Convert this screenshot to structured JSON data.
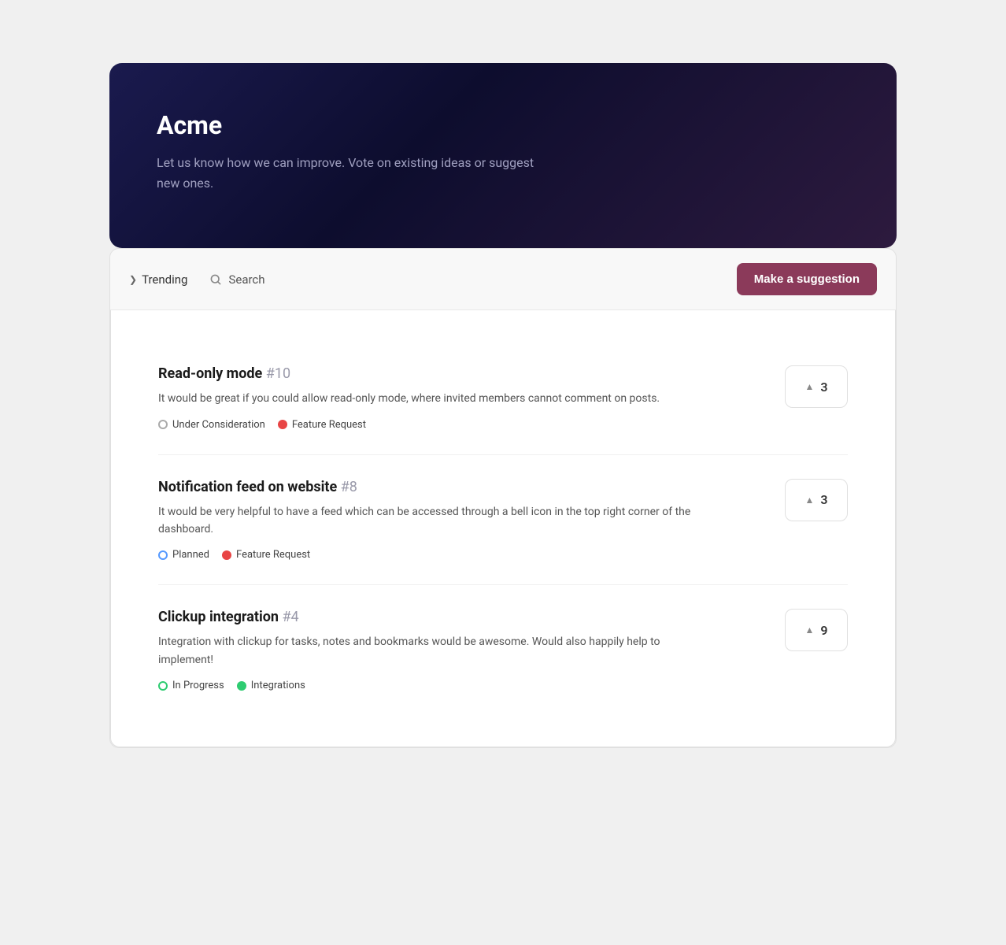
{
  "hero": {
    "title": "Acme",
    "description": "Let us know how we can improve. Vote on existing ideas or suggest new ones."
  },
  "nav": {
    "trending_label": "Trending",
    "search_label": "Search",
    "make_suggestion_label": "Make a suggestion"
  },
  "suggestions": [
    {
      "id": "suggestion-1",
      "title": "Read-only mode",
      "number": "#10",
      "description": "It would be great if you could allow read-only mode, where invited members cannot comment on posts.",
      "tags": [
        {
          "type": "empty",
          "label": "Under Consideration"
        },
        {
          "type": "red",
          "label": "Feature Request"
        }
      ],
      "votes": 3
    },
    {
      "id": "suggestion-2",
      "title": "Notification feed on website",
      "number": "#8",
      "description": "It would be very helpful to have a feed which can be accessed through a bell icon in the top right corner of the dashboard.",
      "tags": [
        {
          "type": "planned",
          "label": "Planned"
        },
        {
          "type": "red",
          "label": "Feature Request"
        }
      ],
      "votes": 3
    },
    {
      "id": "suggestion-3",
      "title": "Clickup integration",
      "number": "#4",
      "description": "Integration with clickup for tasks, notes and bookmarks would be awesome. Would also happily help to implement!",
      "tags": [
        {
          "type": "in-progress",
          "label": "In Progress"
        },
        {
          "type": "green",
          "label": "Integrations"
        }
      ],
      "votes": 9
    }
  ]
}
